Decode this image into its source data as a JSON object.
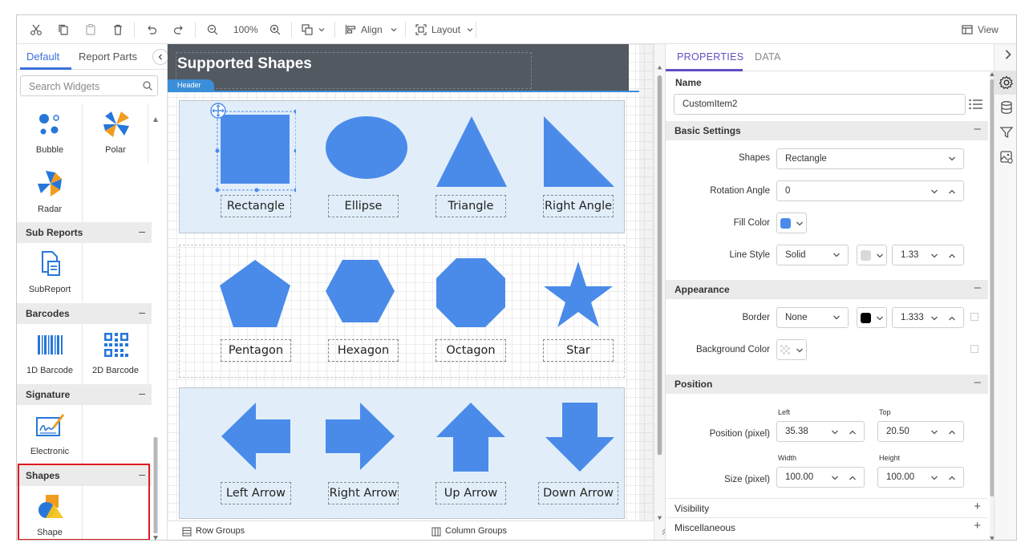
{
  "toolbar": {
    "zoom": "100%",
    "align_label": "Align",
    "layout_label": "Layout",
    "view_label": "View"
  },
  "left_panel": {
    "tabs": [
      "Default",
      "Report Parts"
    ],
    "search_placeholder": "Search Widgets",
    "widgets_top": [
      {
        "label": "Bubble",
        "icon": "bubble-chart-icon"
      },
      {
        "label": "Polar",
        "icon": "polar-chart-icon"
      },
      {
        "label": "Radar",
        "icon": "radar-chart-icon"
      }
    ],
    "sections": [
      {
        "title": "Sub Reports",
        "widgets": [
          {
            "label": "SubReport",
            "icon": "subreport-icon"
          }
        ]
      },
      {
        "title": "Barcodes",
        "widgets": [
          {
            "label": "1D Barcode",
            "icon": "barcode-icon"
          },
          {
            "label": "2D Barcode",
            "icon": "qr-code-icon"
          }
        ]
      },
      {
        "title": "Signature",
        "widgets": [
          {
            "label": "Electronic",
            "icon": "signature-icon"
          }
        ]
      },
      {
        "title": "Shapes",
        "widgets": [
          {
            "label": "Shape",
            "icon": "shape-icon"
          }
        ]
      }
    ],
    "section_toggle": "–"
  },
  "canvas": {
    "header_title": "Supported Shapes",
    "header_tag": "Header",
    "shape_color": "#4a8bea",
    "shapes_row1": [
      "Rectangle",
      "Ellipse",
      "Triangle",
      "Right Angle"
    ],
    "shapes_row2": [
      "Pentagon",
      "Hexagon",
      "Octagon",
      "Star"
    ],
    "shapes_row3": [
      "Left Arrow",
      "Right Arrow",
      "Up Arrow",
      "Down Arrow"
    ],
    "bottom": {
      "row_groups": "Row Groups",
      "column_groups": "Column Groups"
    }
  },
  "properties": {
    "tabs": [
      "PROPERTIES",
      "DATA"
    ],
    "name_label": "Name",
    "name_value": "CustomItem2",
    "basic_settings": {
      "title": "Basic Settings",
      "shapes_label": "Shapes",
      "shapes_value": "Rectangle",
      "rotation_label": "Rotation Angle",
      "rotation_value": "0",
      "fill_label": "Fill Color",
      "fill_color": "#4a8bea",
      "line_style_label": "Line Style",
      "line_style_value": "Solid",
      "line_color": "#d9d9d9",
      "line_width": "1.33"
    },
    "appearance": {
      "title": "Appearance",
      "border_label": "Border",
      "border_value": "None",
      "border_color": "#000000",
      "border_width": "1.333",
      "bg_label": "Background Color"
    },
    "position": {
      "title": "Position",
      "pos_label": "Position (pixel)",
      "left_label": "Left",
      "left_value": "35.38",
      "top_label": "Top",
      "top_value": "20.50",
      "size_label": "Size (pixel)",
      "width_label": "Width",
      "width_value": "100.00",
      "height_label": "Height",
      "height_value": "100.00"
    },
    "visibility": "Visibility",
    "miscellaneous": "Miscellaneous",
    "expand": "+",
    "collapse": "–"
  }
}
